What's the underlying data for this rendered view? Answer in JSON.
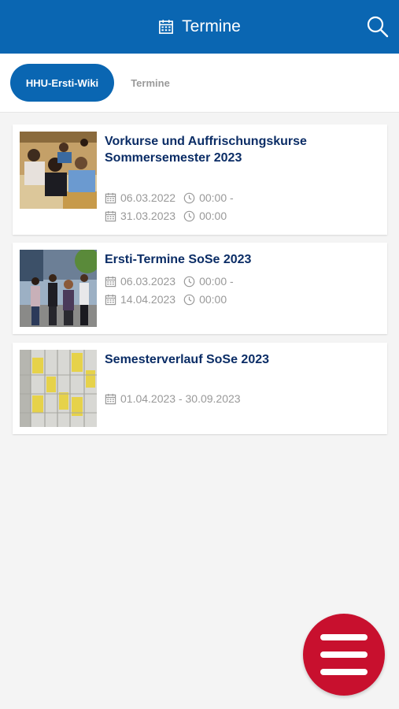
{
  "header": {
    "title": "Termine",
    "title_icon": "calendar-icon",
    "search_icon": "search-icon",
    "color": "#0a66b2"
  },
  "tabs": [
    {
      "label": "HHU-Ersti-Wiki",
      "active": true
    },
    {
      "label": "Termine",
      "active": false
    }
  ],
  "events": [
    {
      "title": "Vorkurse und Auffrischungskurse Sommersemester 2023",
      "image": "lecture hall students photo",
      "start_date": "06.03.2022",
      "start_time": "00:00 -",
      "end_date": "31.03.2023",
      "end_time": "00:00"
    },
    {
      "title": "Ersti-Termine SoSe 2023",
      "image": "students walking photo",
      "start_date": "06.03.2023",
      "start_time": "00:00 -",
      "end_date": "14.04.2023",
      "end_time": "00:00"
    },
    {
      "title": "Semesterverlauf SoSe 2023",
      "image": "lockers photo",
      "date_range": "01.04.2023 - 30.09.2023"
    }
  ],
  "fab": {
    "icon": "menu-icon",
    "color": "#c8102e"
  }
}
